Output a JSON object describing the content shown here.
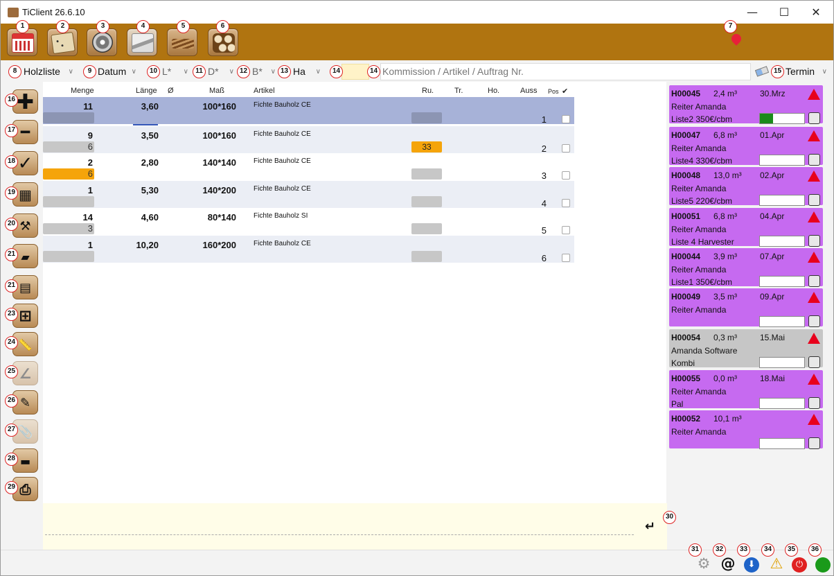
{
  "window": {
    "title": "TiClient 26.6.10",
    "minimize": "—",
    "maximize": "☐",
    "close": "✕"
  },
  "toolbar": {
    "buttons": [
      {
        "badge": "1",
        "icon": "calendar-icon"
      },
      {
        "badge": "2",
        "icon": "notepad-icon"
      },
      {
        "badge": "3",
        "icon": "saw-blade-icon"
      },
      {
        "badge": "4",
        "icon": "lumber-stack-icon"
      },
      {
        "badge": "5",
        "icon": "planks-icon"
      },
      {
        "badge": "6",
        "icon": "firewood-icon"
      }
    ],
    "pin_badge": "7"
  },
  "filters": {
    "list": {
      "badge": "8",
      "value": "Holzliste"
    },
    "sort": {
      "badge": "9",
      "value": "Datum"
    },
    "length": {
      "badge": "10",
      "value": "L*"
    },
    "diameter": {
      "badge": "11",
      "value": "D*"
    },
    "width": {
      "badge": "12",
      "value": "B*"
    },
    "ha": {
      "badge": "13",
      "value": "Ha"
    },
    "yellow_badge": "14",
    "search": {
      "badge": "14",
      "placeholder": "Kommission / Artikel / Auftrag Nr."
    },
    "termin": {
      "badge": "15",
      "value": "Termin"
    }
  },
  "columns": [
    "Menge",
    "Länge",
    "Ø",
    "Maß",
    "Artikel",
    "Ru.",
    "Tr.",
    "Ho.",
    "Auss",
    "Pos",
    "✔"
  ],
  "rows": [
    {
      "menge": "11",
      "laenge": "3,60",
      "mass": "100*160",
      "artikel": "Fichte Bauholz CE",
      "sub": "",
      "ru": "",
      "pos": "1"
    },
    {
      "menge": "9",
      "laenge": "3,50",
      "mass": "100*160",
      "artikel": "Fichte Bauholz CE",
      "sub": "6",
      "ru": "33",
      "pos": "2"
    },
    {
      "menge": "2",
      "laenge": "2,80",
      "mass": "140*140",
      "artikel": "Fichte Bauholz CE",
      "sub": "6",
      "ru": "",
      "pos": "3"
    },
    {
      "menge": "1",
      "laenge": "5,30",
      "mass": "140*200",
      "artikel": "Fichte Bauholz CE",
      "sub": "",
      "ru": "",
      "pos": "4"
    },
    {
      "menge": "14",
      "laenge": "4,60",
      "mass": "80*140",
      "artikel": "Fichte Bauholz SI",
      "sub": "3",
      "ru": "",
      "pos": "5"
    },
    {
      "menge": "1",
      "laenge": "10,20",
      "mass": "160*200",
      "artikel": "Fichte Bauholz CE",
      "sub": "",
      "ru": "",
      "pos": "6"
    }
  ],
  "left_buttons": [
    {
      "badge": "16",
      "icon": "plus-icon",
      "glyph": "✚"
    },
    {
      "badge": "17",
      "icon": "minus-icon",
      "glyph": "━"
    },
    {
      "badge": "18",
      "icon": "checkmark-icon",
      "glyph": "✓"
    },
    {
      "badge": "19",
      "icon": "calculator-icon",
      "glyph": "▦"
    },
    {
      "badge": "20",
      "icon": "hammer-icon",
      "glyph": "⚒"
    },
    {
      "badge": "21",
      "icon": "eraser-icon",
      "glyph": "▰"
    },
    {
      "badge": "21",
      "icon": "wood-stack-icon",
      "glyph": "▤"
    },
    {
      "badge": "23",
      "icon": "add-box-icon",
      "glyph": "⊞"
    },
    {
      "badge": "24",
      "icon": "ruler-icon",
      "glyph": "📏"
    },
    {
      "badge": "25",
      "icon": "angle-tool-icon",
      "glyph": "∠"
    },
    {
      "badge": "26",
      "icon": "edit-document-icon",
      "glyph": "✎"
    },
    {
      "badge": "27",
      "icon": "paperclip-icon",
      "glyph": "📎"
    },
    {
      "badge": "28",
      "icon": "planks-icon",
      "glyph": "▬"
    },
    {
      "badge": "29",
      "icon": "printer-icon",
      "glyph": "⎙"
    }
  ],
  "memo": {
    "enter_badge": "30",
    "enter_glyph": "↵"
  },
  "orders": [
    {
      "id": "H00045",
      "vol": "2,4 m³",
      "date": "30.Mrz",
      "name": "Reiter Amanda",
      "note": "Liste2 350€/cbm",
      "color": "#c66af0",
      "progress": 0.3
    },
    {
      "id": "H00047",
      "vol": "6,8 m³",
      "date": "01.Apr",
      "name": "Reiter Amanda",
      "note": "Liste4 330€/cbm",
      "color": "#c66af0",
      "progress": 0
    },
    {
      "id": "H00048",
      "vol": "13,0 m³",
      "date": "02.Apr",
      "name": "Reiter Amanda",
      "note": "Liste5 220€/cbm",
      "color": "#c66af0",
      "progress": 0
    },
    {
      "id": "H00051",
      "vol": "6,8 m³",
      "date": "04.Apr",
      "name": "Reiter Amanda",
      "note": "Liste 4 Harvester",
      "color": "#c66af0",
      "progress": 0
    },
    {
      "id": "H00044",
      "vol": "3,9 m³",
      "date": "07.Apr",
      "name": "Reiter Amanda",
      "note": "Liste1 350€/cbm",
      "color": "#c66af0",
      "progress": 0
    },
    {
      "id": "H00049",
      "vol": "3,5 m³",
      "date": "09.Apr",
      "name": "Reiter Amanda",
      "note": "",
      "color": "#c66af0",
      "progress": 0
    },
    {
      "id": "H00054",
      "vol": "0,3 m³",
      "date": "15.Mai",
      "name": "Amanda Software",
      "note": "Kombi",
      "color": "#c6c6c6",
      "progress": 0
    },
    {
      "id": "H00055",
      "vol": "0,0 m³",
      "date": "18.Mai",
      "name": "Reiter Amanda",
      "note": "Pal",
      "color": "#c66af0",
      "progress": 0
    },
    {
      "id": "H00052",
      "vol": "10,1 m³",
      "date": "",
      "name": "Reiter Amanda",
      "note": "",
      "color": "#c66af0",
      "progress": 0
    }
  ],
  "status": [
    {
      "badge": "31",
      "icon": "gear-icon",
      "glyph": "⚙"
    },
    {
      "badge": "32",
      "icon": "at-sign-icon",
      "glyph": "@"
    },
    {
      "badge": "33",
      "icon": "download-icon",
      "glyph": "⬇"
    },
    {
      "badge": "34",
      "icon": "warning-icon",
      "glyph": "⚠"
    },
    {
      "badge": "35",
      "icon": "power-icon",
      "glyph": "⏻"
    },
    {
      "badge": "36",
      "icon": "status-online-icon",
      "glyph": ""
    }
  ]
}
